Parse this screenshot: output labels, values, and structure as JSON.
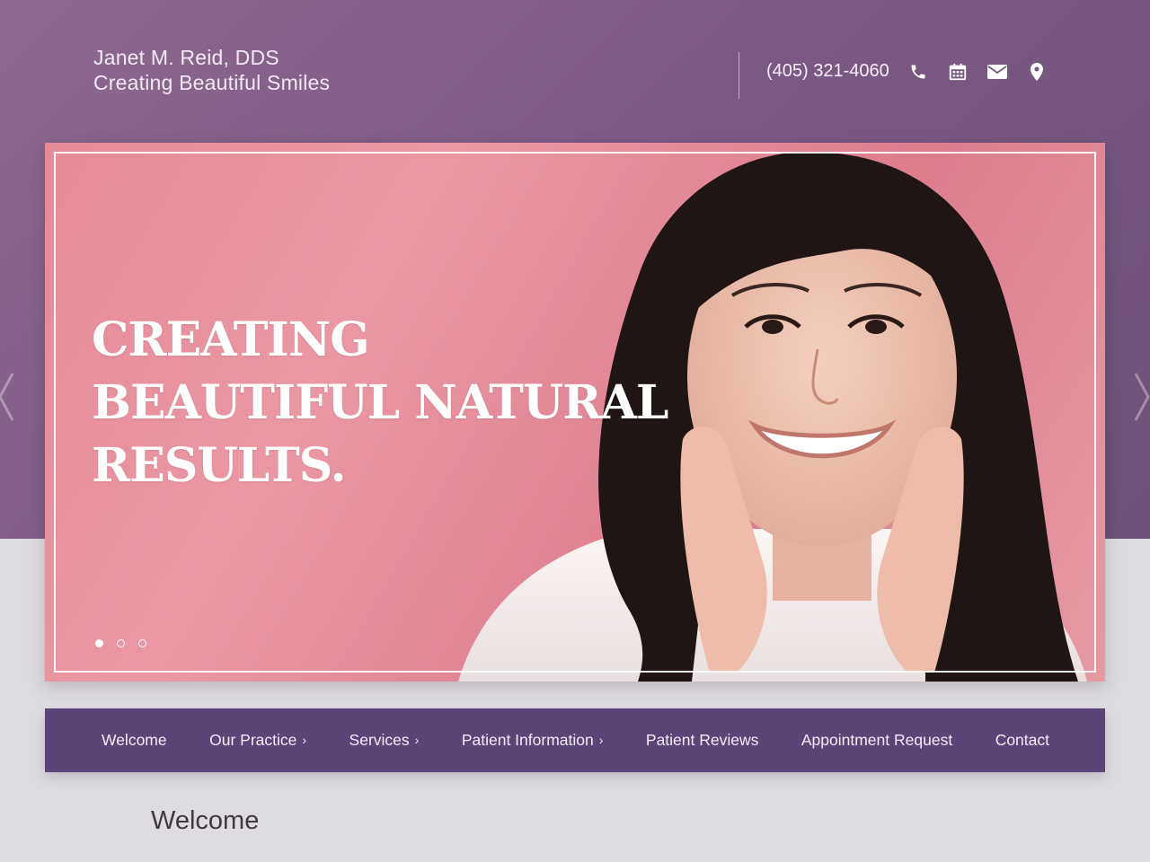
{
  "header": {
    "practice_name": "Janet M. Reid, DDS",
    "tagline": "Creating Beautiful Smiles",
    "phone": "(405) 321-4060",
    "icons": [
      "phone-icon",
      "calendar-icon",
      "envelope-icon",
      "map-pin-icon"
    ]
  },
  "hero": {
    "headline_line1": "CREATING",
    "headline_line2": "BEAUTIFUL NATURAL",
    "headline_line3": "RESULTS.",
    "slide_count": 3,
    "active_slide": 1
  },
  "nav": {
    "items": [
      {
        "label": "Welcome",
        "has_submenu": false
      },
      {
        "label": "Our Practice",
        "has_submenu": true
      },
      {
        "label": "Services",
        "has_submenu": true
      },
      {
        "label": "Patient Information",
        "has_submenu": true
      },
      {
        "label": "Patient Reviews",
        "has_submenu": false
      },
      {
        "label": "Appointment Request",
        "has_submenu": false
      },
      {
        "label": "Contact",
        "has_submenu": false
      }
    ]
  },
  "main": {
    "section_title": "Welcome"
  },
  "colors": {
    "header_bg": "#7b5a84",
    "hero_bg": "#e58a98",
    "nav_bg": "#5b4478",
    "page_bg": "#dedbe2"
  }
}
